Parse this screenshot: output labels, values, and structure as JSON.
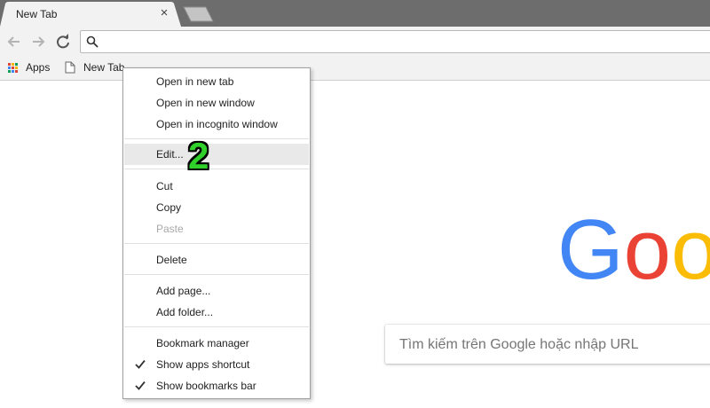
{
  "tab": {
    "title": "New Tab",
    "close_glyph": "×",
    "close_icon": "close-icon"
  },
  "toolbar": {
    "back_icon": "back-arrow-icon",
    "forward_icon": "forward-arrow-icon",
    "reload_icon": "reload-icon",
    "omnibox_value": "",
    "omnibox_icon": "search-icon"
  },
  "bookmarks_bar": {
    "apps_label": "Apps",
    "bookmark_label": "New Tab",
    "apps_colors": [
      "#db4437",
      "#f4b400",
      "#0f9d58",
      "#4285f4",
      "#db4437",
      "#f4b400",
      "#0f9d58",
      "#4285f4",
      "#db4437"
    ]
  },
  "context_menu": {
    "open_new_tab": "Open in new tab",
    "open_new_window": "Open in new window",
    "open_incognito": "Open in incognito window",
    "edit": "Edit...",
    "cut": "Cut",
    "copy": "Copy",
    "paste": "Paste",
    "delete": "Delete",
    "add_page": "Add page...",
    "add_folder": "Add folder...",
    "bookmark_manager": "Bookmark manager",
    "show_apps_shortcut": "Show apps shortcut",
    "show_bookmarks_bar": "Show bookmarks bar",
    "paste_enabled": false,
    "show_apps_shortcut_checked": true,
    "show_bookmarks_bar_checked": true,
    "hovered_item": "edit"
  },
  "annotation": {
    "step_number": "2",
    "color": "#2fd02a"
  },
  "content": {
    "logo_text": "Goo",
    "logo_colors": [
      "#4285f4",
      "#ea4335",
      "#fbbc05"
    ],
    "search_placeholder": "Tìm kiếm trên Google hoặc nhập URL"
  }
}
